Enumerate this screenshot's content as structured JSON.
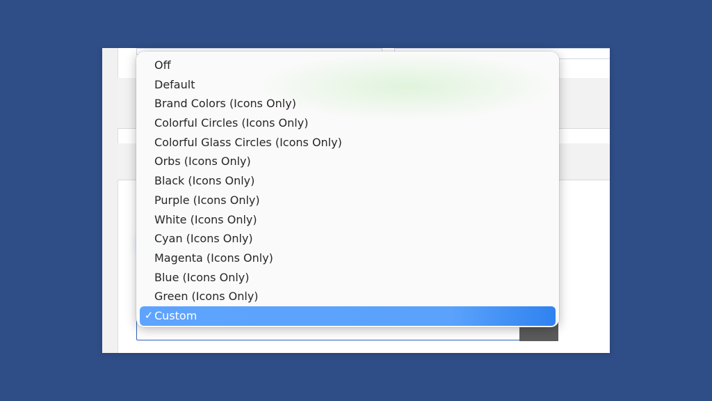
{
  "dropdown": {
    "options": [
      {
        "label": "Off"
      },
      {
        "label": "Default"
      },
      {
        "label": "Brand Colors (Icons Only)"
      },
      {
        "label": "Colorful Circles (Icons Only)"
      },
      {
        "label": "Colorful Glass Circles (Icons Only)"
      },
      {
        "label": "Orbs (Icons Only)"
      },
      {
        "label": "Black (Icons Only)"
      },
      {
        "label": "Purple (Icons Only)"
      },
      {
        "label": "White (Icons Only)"
      },
      {
        "label": "Cyan (Icons Only)"
      },
      {
        "label": "Magenta (Icons Only)"
      },
      {
        "label": "Blue (Icons Only)"
      },
      {
        "label": "Green (Icons Only)"
      },
      {
        "label": "Custom"
      }
    ],
    "selected_index": 13,
    "check_glyph": "✓",
    "selection_color": "#5ea4ff"
  },
  "colors": {
    "background": "#2f4d87",
    "panel": "#ffffff",
    "select_border": "#2f62b8"
  }
}
